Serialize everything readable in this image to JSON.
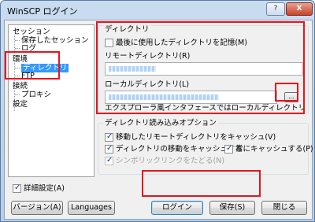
{
  "window": {
    "title": "WinSCP ログイン",
    "help_label": "?",
    "close_label": "X"
  },
  "tree": [
    {
      "label": "セッション",
      "level": 0,
      "selected": false
    },
    {
      "label": "保存したセッション",
      "level": 1,
      "selected": false
    },
    {
      "label": "ログ",
      "level": 1,
      "selected": false
    },
    {
      "label": "環境",
      "level": 0,
      "selected": false
    },
    {
      "label": "ディレクトリ",
      "level": 1,
      "selected": true
    },
    {
      "label": "FTP",
      "level": 1,
      "selected": false
    },
    {
      "label": "接続",
      "level": 0,
      "selected": false
    },
    {
      "label": "プロキシ",
      "level": 1,
      "selected": false
    },
    {
      "label": "設定",
      "level": 0,
      "selected": false
    }
  ],
  "directories": {
    "title": "ディレクトリ",
    "remember_last_label": "最後に使用したディレクトリを記憶(M)",
    "remember_last_checked": false,
    "remote_dir_label": "リモートディレクトリ(R)",
    "remote_dir_value": "",
    "local_dir_label": "ローカルディレクトリ(L)",
    "local_dir_value": "",
    "browse_label": "...",
    "note": "エクスプローラ風インタフェースではローカルディレクトリは使用しませ"
  },
  "read_options": {
    "title": "ディレクトリ読み込みオプション",
    "cache_remote_label": "移動したリモートディレクトリをキャッシュ(V)",
    "cache_remote_checked": true,
    "cache_changes_label": "ディレクトリの移動をキャッシュする",
    "cache_changes_checked": true,
    "always_cache_label": "常にキャッシュする(P)",
    "always_cache_checked": true,
    "resolve_symlinks_label": "シンボリックリンクをたどる(N)",
    "resolve_symlinks_checked": true,
    "resolve_symlinks_disabled": true
  },
  "advanced": {
    "label": "詳細設定(A)",
    "checked": true
  },
  "buttons": {
    "version": "バージョン(A)",
    "languages": "Languages",
    "login": "ログイン",
    "save": "保存(S)",
    "close": "閉じる"
  }
}
